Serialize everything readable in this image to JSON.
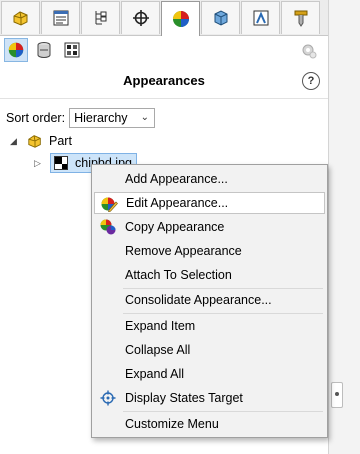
{
  "panel": {
    "title": "Appearances",
    "help_label": "?",
    "sort_label": "Sort order:",
    "sort_value": "Hierarchy"
  },
  "tabs": [
    {
      "icon": "part-yellow-icon"
    },
    {
      "icon": "property-manager-icon"
    },
    {
      "icon": "configuration-manager-icon"
    },
    {
      "icon": "crosshair-icon"
    },
    {
      "icon": "appearances-ball-icon",
      "active": true
    },
    {
      "icon": "display-cube-icon"
    },
    {
      "icon": "cam-icon"
    },
    {
      "icon": "tool-icon"
    }
  ],
  "tree": {
    "root_label": "Part",
    "child_label": "chipbd.jpg"
  },
  "context_menu": {
    "items": [
      {
        "label": "Add Appearance...",
        "icon": null
      },
      {
        "label": "Edit Appearance...",
        "icon": "edit-appearance-icon",
        "highlighted": true
      },
      {
        "label": "Copy Appearance",
        "icon": "copy-appearance-icon"
      },
      {
        "label": "Remove Appearance",
        "icon": null
      },
      {
        "label": "Attach To Selection",
        "icon": null
      },
      {
        "label": "Consolidate Appearance...",
        "icon": null
      },
      {
        "label": "Expand Item",
        "icon": null
      },
      {
        "label": "Collapse All",
        "icon": null
      },
      {
        "label": "Expand All",
        "icon": null
      },
      {
        "label": "Display States Target",
        "icon": "target-icon"
      },
      {
        "label": "Customize Menu",
        "icon": null
      }
    ]
  },
  "colors": {
    "menu_bg": "#f2f2f2",
    "selection_bg": "#cde4f9",
    "selection_border": "#7fb2e5"
  }
}
